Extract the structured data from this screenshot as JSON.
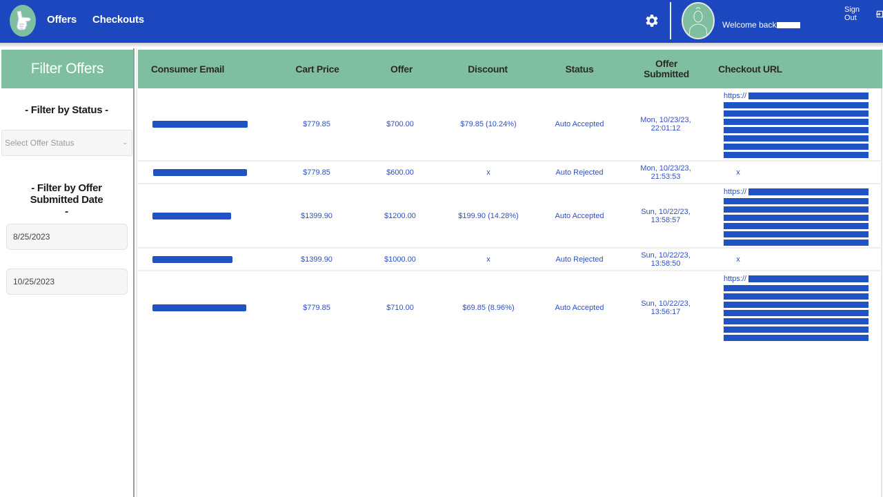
{
  "header": {
    "nav": [
      {
        "label": "Offers"
      },
      {
        "label": "Checkouts"
      }
    ],
    "welcome": "Welcome back",
    "sign_out": "Sign Out",
    "icons": {
      "logo": "thumbs-up-hand-logo",
      "settings": "gear-icon",
      "avatar": "user-avatar",
      "sign_out": "sign-out-icon"
    }
  },
  "sidebar": {
    "title": "Filter Offers",
    "status_filter_title": "- Filter by Status -",
    "status_select_placeholder": "Select Offer Status",
    "date_filter_title": "- Filter by Offer Submitted Date -",
    "date_from": "8/25/2023",
    "date_to": "10/25/2023"
  },
  "table": {
    "columns": [
      "Consumer Email",
      "Cart Price",
      "Offer",
      "Discount",
      "Status",
      "Offer Submitted",
      "Checkout URL"
    ],
    "rows": [
      {
        "email": "[redacted]",
        "cart_price": "$779.85",
        "offer": "$700.00",
        "discount": "$79.85 (10.24%)",
        "status": "Auto Accepted",
        "submitted_date": "Mon, 10/23/23,",
        "submitted_time": "22:01:12",
        "checkout_url": "https://[redacted]"
      },
      {
        "email": "[redacted]",
        "cart_price": "$779.85",
        "offer": "$600.00",
        "discount": "x",
        "status": "Auto Rejected",
        "submitted_date": "Mon, 10/23/23,",
        "submitted_time": "21:53:53",
        "checkout_url": "x"
      },
      {
        "email": "[redacted]",
        "cart_price": "$1399.90",
        "offer": "$1200.00",
        "discount": "$199.90 (14.28%)",
        "status": "Auto Accepted",
        "submitted_date": "Sun, 10/22/23,",
        "submitted_time": "13:58:57",
        "checkout_url": "https://[redacted]"
      },
      {
        "email": "[redacted]",
        "cart_price": "$1399.90",
        "offer": "$1000.00",
        "discount": "x",
        "status": "Auto Rejected",
        "submitted_date": "Sun, 10/22/23,",
        "submitted_time": "13:58:50",
        "checkout_url": "x"
      },
      {
        "email": "[redacted]",
        "cart_price": "$779.85",
        "offer": "$710.00",
        "discount": "$69.85 (8.96%)",
        "status": "Auto Accepted",
        "submitted_date": "Sun, 10/22/23,",
        "submitted_time": "13:56:17",
        "checkout_url": "https://[redacted]"
      }
    ],
    "url_prefix": "https://"
  },
  "colors": {
    "topbar": "#1c47bf",
    "accent_green": "#7fbf9f",
    "cell_text": "#2f4fc0",
    "redaction": "#1f52c4"
  }
}
